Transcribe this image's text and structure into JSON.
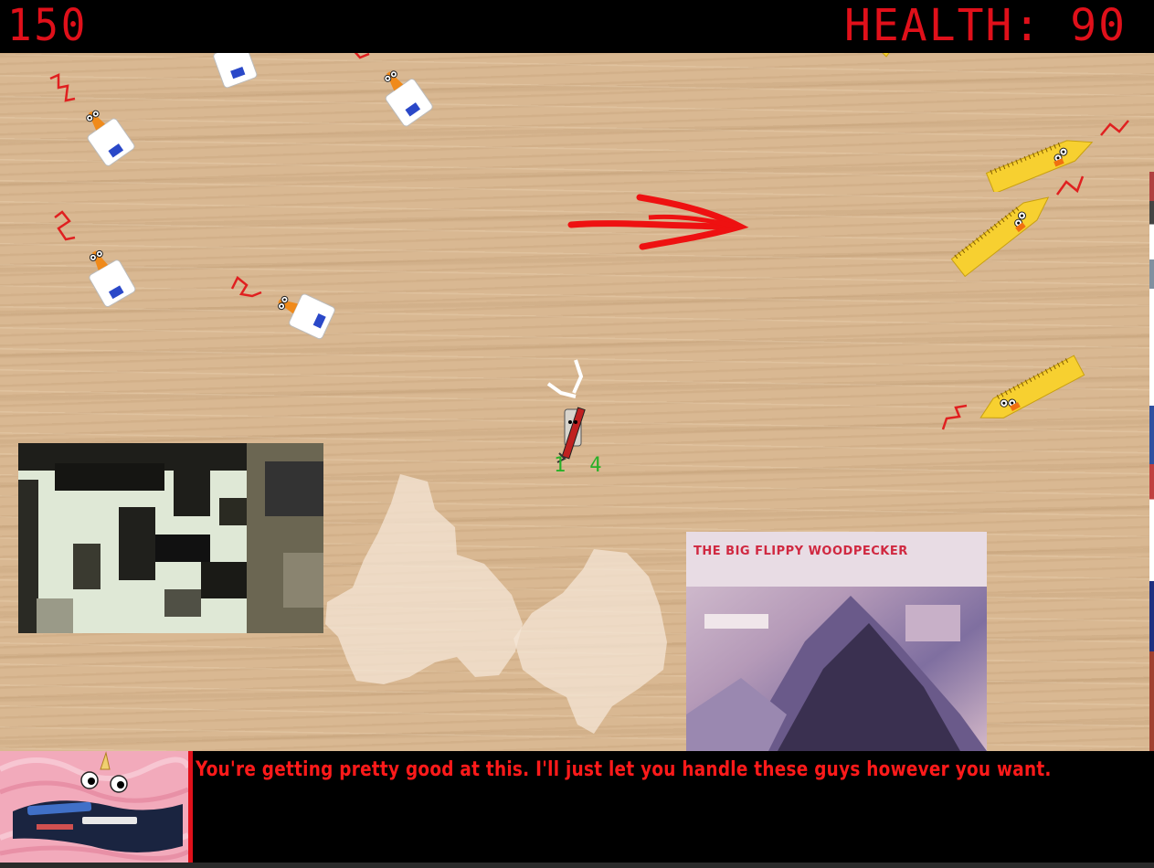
{
  "hud": {
    "score": "150",
    "health_label": "HEALTH:",
    "health_value": "90"
  },
  "player": {
    "ammo_left": "1",
    "ammo_right": "4"
  },
  "enemies": {
    "glue_bottles": 6,
    "rulers": 4
  },
  "photos": {
    "album_cover_text": "THE BIG FLIPPY WOODPECKER"
  },
  "dialog": {
    "text": "You're getting pretty good at this. I'll just let you handle these guys however you want."
  },
  "colors": {
    "hud_red": "#e0101a",
    "arrow_red": "#ee1111",
    "dialog_red": "#ff1a1a",
    "background": "#000000"
  }
}
